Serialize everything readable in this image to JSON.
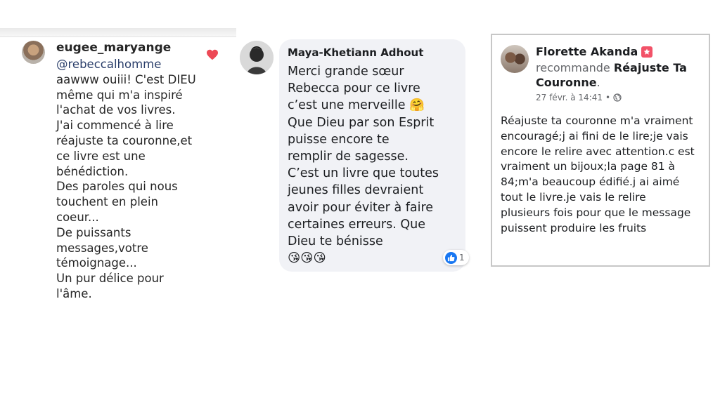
{
  "instagram_comment": {
    "username": "eugee_maryange",
    "mention": "@rebeccalhomme",
    "text": "aawww ouiii! C'est DIEU\nmême qui m'a inspiré\nl'achat de vos livres.\nJ'ai commencé à lire\nréajuste ta couronne,et\nce livre est une\nbénédiction.\nDes paroles qui nous\ntouchent en plein\ncoeur...\nDe puissants\nmessages,votre\ntémoignage...\nUn pur délice pour\nl'âme.",
    "heart_icon": "heart-icon",
    "heart_color": "#ed4956"
  },
  "facebook_comment": {
    "author": "Maya-Khetiann Adhout",
    "text": "Merci grande sœur\nRebecca pour ce livre\nc’est une merveille 🤗\nQue Dieu par son Esprit\npuisse encore te\nremplir de sagesse.\nC’est un livre que toutes\njeunes filles devraient\navoir pour éviter à faire\ncertaines erreurs. Que\nDieu te bénisse\n😘😘😘",
    "reaction_count": "1",
    "like_color": "#1877f2"
  },
  "facebook_recommendation": {
    "author": "Florette Akanda",
    "verb": "recommande",
    "page": "Réajuste Ta Couronne",
    "date": "27 févr. à 14:41",
    "separator": "•",
    "globe_icon": "globe-icon",
    "text": "Réajuste ta couronne m'a vraiment\nencouragé;j ai fini de le lire;je vais\nencore le relire avec attention.c est\nvraiment un bijoux;la  page 81 à\n84;m'a beaucoup édifié.j ai aimé\ntout le livre.je vais le relire\nplusieurs fois pour que le message\npuissent produire les fruits",
    "badge_color": "#f25268"
  }
}
